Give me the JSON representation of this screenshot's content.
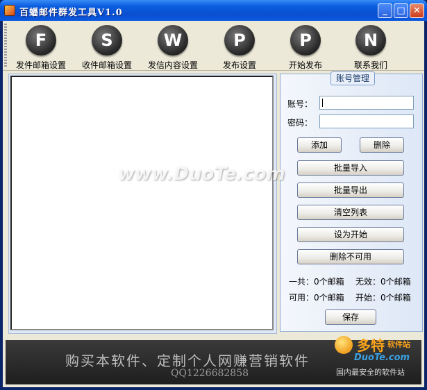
{
  "window": {
    "title": "百蟠邮件群发工具V1.0",
    "min_glyph": "_",
    "max_glyph": "□",
    "close_glyph": "✕"
  },
  "toolbar": {
    "items": [
      {
        "label": "发件邮箱设置",
        "icon": "fi-icon",
        "glyph": "F"
      },
      {
        "label": "收件邮箱设置",
        "icon": "s-icon",
        "glyph": "S"
      },
      {
        "label": "发信内容设置",
        "icon": "w-icon",
        "glyph": "W"
      },
      {
        "label": "发布设置",
        "icon": "p-icon",
        "glyph": "P"
      },
      {
        "label": "开始发布",
        "icon": "p-icon",
        "glyph": "P"
      },
      {
        "label": "联系我们",
        "icon": "n-icon",
        "glyph": "N"
      }
    ]
  },
  "account": {
    "group_title": "账号管理",
    "account_label": "账号：",
    "password_label": "密码：",
    "account_value": "",
    "password_value": "",
    "add_label": "添加",
    "delete_label": "删除",
    "import_label": "批量导入",
    "export_label": "批量导出",
    "clear_label": "清空列表",
    "set_start_label": "设为开始",
    "delete_unavailable_label": "删除不可用",
    "total_label": "一共：",
    "total_value": "0个邮箱",
    "invalid_label": "无效：",
    "invalid_value": "0个邮箱",
    "available_label": "可用：",
    "available_value": "0个邮箱",
    "start_label": "开始：",
    "start_value": "0个邮箱",
    "save_label": "保存"
  },
  "footer": {
    "ad_text": "购买本软件、定制个人网赚营销软件",
    "qq_text": "QQ1226682858"
  },
  "watermark": {
    "text": "www.DuoTe.com",
    "logo_cn": "多特",
    "logo_site": "软件站",
    "logo_en": "DuoTe.com",
    "logo_tagline": "国内最安全的软件站"
  },
  "colors": {
    "title_bar": "#0b5de0",
    "panel_border": "#8eaad6",
    "logo_orange": "#f7a21a"
  }
}
